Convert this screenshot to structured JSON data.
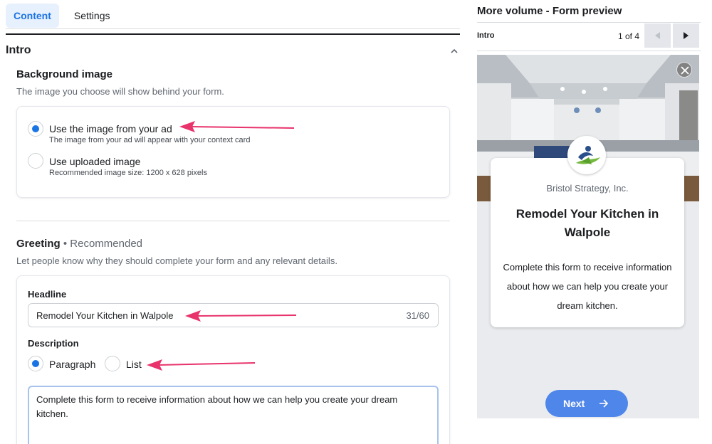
{
  "tabs": [
    {
      "label": "Content",
      "active": true
    },
    {
      "label": "Settings",
      "active": false
    }
  ],
  "section": {
    "title": "Intro"
  },
  "background_image": {
    "title": "Background image",
    "hint": "The image you choose will show behind your form.",
    "options": [
      {
        "label": "Use the image from your ad",
        "hint": "The image from your ad will appear with your context card",
        "selected": true
      },
      {
        "label": "Use uploaded image",
        "hint": "Recommended image size: 1200 x 628 pixels",
        "selected": false
      }
    ]
  },
  "greeting": {
    "title": "Greeting",
    "recommended": "• Recommended",
    "hint": "Let people know why they should complete your form and any relevant details.",
    "headline_label": "Headline",
    "headline_value": "Remodel Your Kitchen in Walpole",
    "headline_count": "31/60",
    "description_label": "Description",
    "description_options": [
      {
        "label": "Paragraph",
        "selected": true
      },
      {
        "label": "List",
        "selected": false
      }
    ],
    "description_value": "Complete this form to receive information about how we can help you create your dream kitchen."
  },
  "preview": {
    "title": "More volume - Form preview",
    "step": "Intro",
    "page": "1 of 4",
    "company": "Bristol Strategy, Inc.",
    "headline": "Remodel Your Kitchen in Walpole",
    "description": "Complete this form to receive information about how we can help you create your dream kitchen.",
    "next_label": "Next"
  },
  "colors": {
    "accent": "#1b74e4",
    "annotation_arrow": "#e8336c",
    "next_button": "#4f86ea"
  },
  "icons": {
    "collapse": "chevron-up-icon",
    "prev": "triangle-left-icon",
    "next": "triangle-right-icon",
    "close": "close-icon",
    "next_arrow": "arrow-right-icon"
  }
}
